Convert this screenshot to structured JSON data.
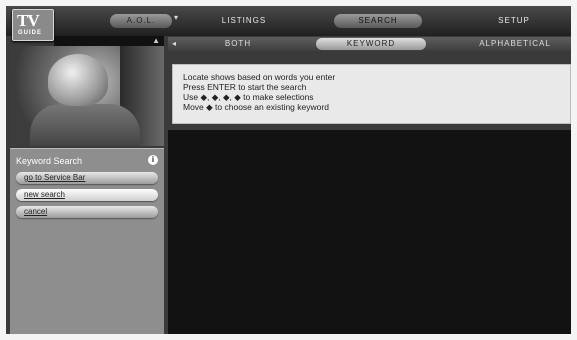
{
  "logo": {
    "tv": "TV",
    "guide": "GUIDE"
  },
  "top_nav": {
    "aol": "A.O.L.",
    "listings": "LISTINGS",
    "search": "SEARCH",
    "setup": "SETUP"
  },
  "sub_tabs": {
    "both": "BOTH",
    "keyword": "KEYWORD",
    "alphabetical": "ALPHABETICAL"
  },
  "left_panel": {
    "title": "Keyword Search",
    "help_icon": "i",
    "buttons": {
      "service_bar": "go to Service Bar",
      "new_search": "new search",
      "cancel": "cancel"
    }
  },
  "info": {
    "line1": "Locate shows based on words you enter",
    "line2": "Press ENTER to start the search",
    "line3": "Use ◆, ◆, ◆, ◆ to make selections",
    "line4": "Move ◆ to choose an existing keyword"
  },
  "icons": {
    "caret": "▾",
    "scroll_up": "▲",
    "left_arrow": "◂"
  }
}
